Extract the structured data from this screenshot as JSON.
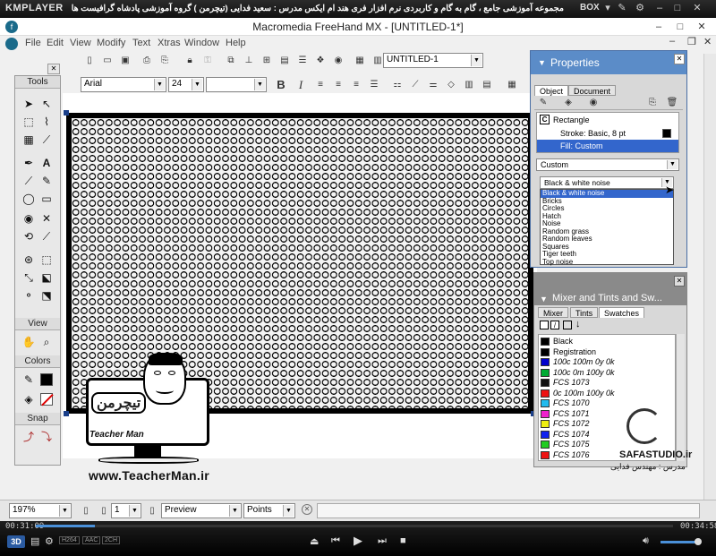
{
  "player": {
    "name": "KMPLAYER",
    "course_title": "مجموعه آموزشی جامع ، گام به گام و کاربردی نرم افزار فری هند ام ایکس  مدرس : سعید فدایی (تیچرمن ) گروه آموزشی پادشاه گرافیست ها",
    "box_label": "BOX",
    "time_elapsed": "00:31:09",
    "time_total": "00:34:58",
    "progress_fraction": 0.093,
    "badges": [
      "H264",
      "AAC",
      "2CH"
    ],
    "badge_3d": "3D"
  },
  "app": {
    "title": "Macromedia FreeHand MX - [UNTITLED-1*]",
    "menu": [
      "File",
      "Edit",
      "View",
      "Modify",
      "Text",
      "Xtras",
      "Window",
      "Help"
    ],
    "document_name": "UNTITLED-1",
    "font_name": "Arial",
    "font_size": "24"
  },
  "tools_panel": {
    "header": "Tools",
    "view_label": "View",
    "colors_label": "Colors",
    "snap_label": "Snap"
  },
  "properties": {
    "title": "Properties",
    "tabs": [
      "Object",
      "Document"
    ],
    "objects": [
      {
        "label": "Rectangle"
      },
      {
        "label": "Stroke: Basic, 8 pt"
      },
      {
        "label": "Fill: Custom",
        "selected": true
      }
    ],
    "fill_type": "Custom",
    "texture_selected": "Black & white noise",
    "texture_options": [
      "Black & white noise",
      "Bricks",
      "Circles",
      "Hatch",
      "Noise",
      "Random grass",
      "Random leaves",
      "Squares",
      "Tiger teeth",
      "Top noise"
    ]
  },
  "mixer": {
    "title": "Mixer and Tints and Sw...",
    "tabs": [
      "Mixer",
      "Tints",
      "Swatches"
    ],
    "swatches": [
      {
        "name": "Black",
        "color": "#000000",
        "italic": false
      },
      {
        "name": "Registration",
        "color": "#000000",
        "italic": false
      },
      {
        "name": "100c 100m 0y 0k",
        "color": "#0000cc",
        "italic": true
      },
      {
        "name": "100c 0m 100y 0k",
        "color": "#00aa33",
        "italic": true
      },
      {
        "name": "FCS 1073",
        "color": "#111111",
        "italic": true
      },
      {
        "name": "0c 100m 100y 0k",
        "color": "#ee1111",
        "italic": true
      },
      {
        "name": "FCS 1070",
        "color": "#22bbee",
        "italic": true
      },
      {
        "name": "FCS 1071",
        "color": "#ee22cc",
        "italic": true
      },
      {
        "name": "FCS 1072",
        "color": "#eeee11",
        "italic": true
      },
      {
        "name": "FCS 1074",
        "color": "#1122ee",
        "italic": true
      },
      {
        "name": "FCS 1075",
        "color": "#22cc22",
        "italic": true
      },
      {
        "name": "FCS 1076",
        "color": "#ee1111",
        "italic": true
      }
    ]
  },
  "status_bar": {
    "zoom": "197%",
    "page": "1",
    "view_mode": "Preview",
    "units": "Points"
  },
  "watermarks": {
    "teacher_fa": "تیچرمن",
    "teacher_en": "Teacher Man",
    "site": "www.TeacherMan.ir",
    "safa": "SAFASTUDIO.ir",
    "teacher_credit": "مدرس : مهندس فدایی"
  },
  "colors": {
    "accent_blue": "#5b8cc8",
    "selection_blue": "#3366cc"
  }
}
